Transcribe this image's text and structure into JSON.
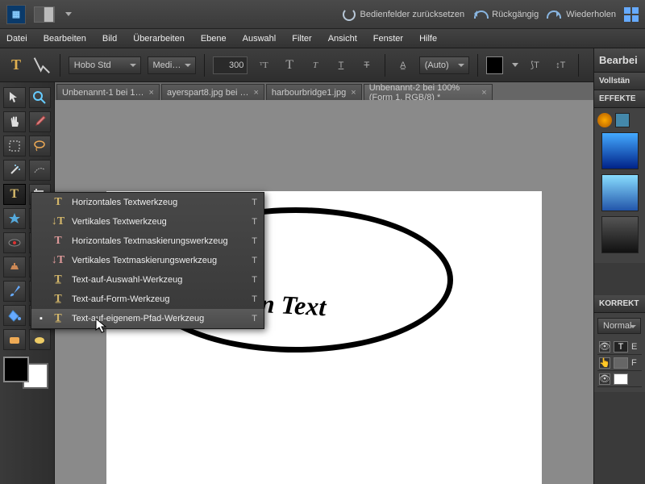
{
  "topbar": {
    "reset_panels": "Bedienfelder zurücksetzen",
    "undo": "Rückgängig",
    "redo": "Wiederholen"
  },
  "menu": {
    "file": "Datei",
    "edit": "Bearbeiten",
    "image": "Bild",
    "enhance": "Überarbeiten",
    "layer": "Ebene",
    "select": "Auswahl",
    "filter": "Filter",
    "view": "Ansicht",
    "window": "Fenster",
    "help": "Hilfe"
  },
  "options": {
    "font_family": "Hobo Std",
    "font_style": "Medi…",
    "font_size": "300",
    "leading": "(Auto)"
  },
  "tabs": [
    {
      "label": "Unbenannt-1 bei 1…"
    },
    {
      "label": "ayerspart8.jpg bei …"
    },
    {
      "label": "harbourbridge1.jpg"
    },
    {
      "label": "Unbenannt-2 bei 100% (Form 1, RGB/8) *"
    }
  ],
  "flyout": [
    {
      "label": "Horizontales Textwerkzeug",
      "key": "T"
    },
    {
      "label": "Vertikales Textwerkzeug",
      "key": "T"
    },
    {
      "label": "Horizontales Textmaskierungswerkzeug",
      "key": "T"
    },
    {
      "label": "Vertikales Textmaskierungswerkzeug",
      "key": "T"
    },
    {
      "label": "Text-auf-Auswahl-Werkzeug",
      "key": "T"
    },
    {
      "label": "Text-auf-Form-Werkzeug",
      "key": "T"
    },
    {
      "label": "Text-auf-eigenem-Pfad-Werkzeug",
      "key": "T"
    }
  ],
  "canvas": {
    "text": "Das ist ein Text"
  },
  "panels": {
    "edit": "Bearbei",
    "full": "Vollstän",
    "effects": "EFFEKTE",
    "corrections": "KORREKT",
    "blend": "Normal",
    "layer_t": "E",
    "layer_f": "F"
  }
}
